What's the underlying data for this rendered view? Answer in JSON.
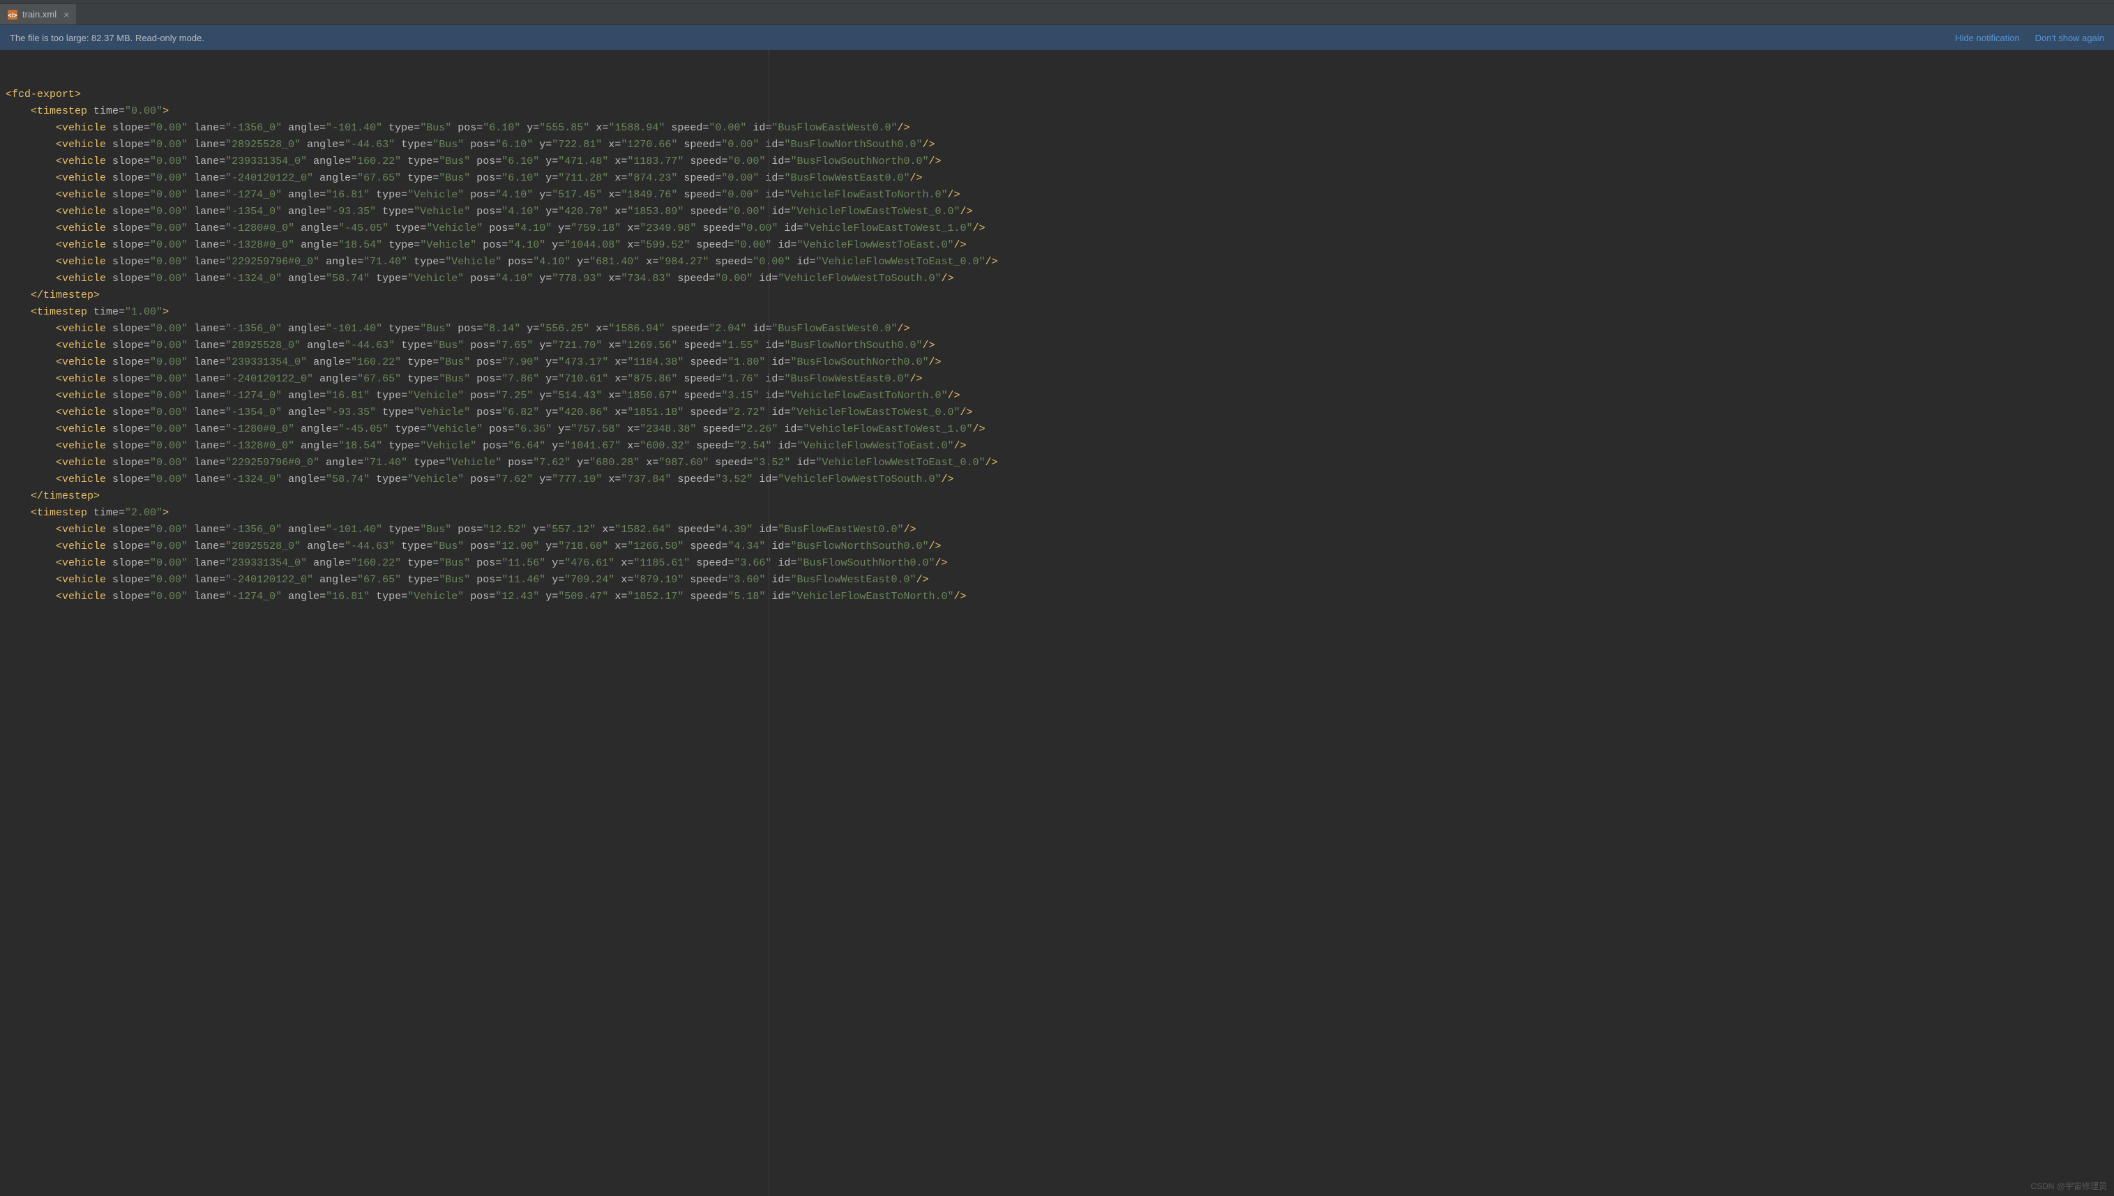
{
  "tab": {
    "filename": "train.xml"
  },
  "notification": {
    "message": "The file is too large: 82.37 MB. Read-only mode.",
    "hide": "Hide notification",
    "dontshow": "Don't show again"
  },
  "watermark": "CSDN @宇宙修理员",
  "xml": {
    "root": "fcd-export",
    "timesteps": [
      {
        "time": "0.00",
        "vehicles": [
          {
            "slope": "0.00",
            "lane": "-1356_0",
            "angle": "-101.40",
            "type": "Bus",
            "pos": "6.10",
            "y": "555.85",
            "x": "1588.94",
            "speed": "0.00",
            "id": "BusFlowEastWest0.0"
          },
          {
            "slope": "0.00",
            "lane": "28925528_0",
            "angle": "-44.63",
            "type": "Bus",
            "pos": "6.10",
            "y": "722.81",
            "x": "1270.66",
            "speed": "0.00",
            "id": "BusFlowNorthSouth0.0"
          },
          {
            "slope": "0.00",
            "lane": "239331354_0",
            "angle": "160.22",
            "type": "Bus",
            "pos": "6.10",
            "y": "471.48",
            "x": "1183.77",
            "speed": "0.00",
            "id": "BusFlowSouthNorth0.0"
          },
          {
            "slope": "0.00",
            "lane": "-240120122_0",
            "angle": "67.65",
            "type": "Bus",
            "pos": "6.10",
            "y": "711.28",
            "x": "874.23",
            "speed": "0.00",
            "id": "BusFlowWestEast0.0"
          },
          {
            "slope": "0.00",
            "lane": "-1274_0",
            "angle": "16.81",
            "type": "Vehicle",
            "pos": "4.10",
            "y": "517.45",
            "x": "1849.76",
            "speed": "0.00",
            "id": "VehicleFlowEastToNorth.0"
          },
          {
            "slope": "0.00",
            "lane": "-1354_0",
            "angle": "-93.35",
            "type": "Vehicle",
            "pos": "4.10",
            "y": "420.70",
            "x": "1853.89",
            "speed": "0.00",
            "id": "VehicleFlowEastToWest_0.0"
          },
          {
            "slope": "0.00",
            "lane": "-1280#0_0",
            "angle": "-45.05",
            "type": "Vehicle",
            "pos": "4.10",
            "y": "759.18",
            "x": "2349.98",
            "speed": "0.00",
            "id": "VehicleFlowEastToWest_1.0"
          },
          {
            "slope": "0.00",
            "lane": "-1328#0_0",
            "angle": "18.54",
            "type": "Vehicle",
            "pos": "4.10",
            "y": "1044.08",
            "x": "599.52",
            "speed": "0.00",
            "id": "VehicleFlowWestToEast.0"
          },
          {
            "slope": "0.00",
            "lane": "229259796#0_0",
            "angle": "71.40",
            "type": "Vehicle",
            "pos": "4.10",
            "y": "681.40",
            "x": "984.27",
            "speed": "0.00",
            "id": "VehicleFlowWestToEast_0.0"
          },
          {
            "slope": "0.00",
            "lane": "-1324_0",
            "angle": "58.74",
            "type": "Vehicle",
            "pos": "4.10",
            "y": "778.93",
            "x": "734.83",
            "speed": "0.00",
            "id": "VehicleFlowWestToSouth.0"
          }
        ]
      },
      {
        "time": "1.00",
        "vehicles": [
          {
            "slope": "0.00",
            "lane": "-1356_0",
            "angle": "-101.40",
            "type": "Bus",
            "pos": "8.14",
            "y": "556.25",
            "x": "1586.94",
            "speed": "2.04",
            "id": "BusFlowEastWest0.0"
          },
          {
            "slope": "0.00",
            "lane": "28925528_0",
            "angle": "-44.63",
            "type": "Bus",
            "pos": "7.65",
            "y": "721.70",
            "x": "1269.56",
            "speed": "1.55",
            "id": "BusFlowNorthSouth0.0"
          },
          {
            "slope": "0.00",
            "lane": "239331354_0",
            "angle": "160.22",
            "type": "Bus",
            "pos": "7.90",
            "y": "473.17",
            "x": "1184.38",
            "speed": "1.80",
            "id": "BusFlowSouthNorth0.0"
          },
          {
            "slope": "0.00",
            "lane": "-240120122_0",
            "angle": "67.65",
            "type": "Bus",
            "pos": "7.86",
            "y": "710.61",
            "x": "875.86",
            "speed": "1.76",
            "id": "BusFlowWestEast0.0"
          },
          {
            "slope": "0.00",
            "lane": "-1274_0",
            "angle": "16.81",
            "type": "Vehicle",
            "pos": "7.25",
            "y": "514.43",
            "x": "1850.67",
            "speed": "3.15",
            "id": "VehicleFlowEastToNorth.0"
          },
          {
            "slope": "0.00",
            "lane": "-1354_0",
            "angle": "-93.35",
            "type": "Vehicle",
            "pos": "6.82",
            "y": "420.86",
            "x": "1851.18",
            "speed": "2.72",
            "id": "VehicleFlowEastToWest_0.0"
          },
          {
            "slope": "0.00",
            "lane": "-1280#0_0",
            "angle": "-45.05",
            "type": "Vehicle",
            "pos": "6.36",
            "y": "757.58",
            "x": "2348.38",
            "speed": "2.26",
            "id": "VehicleFlowEastToWest_1.0"
          },
          {
            "slope": "0.00",
            "lane": "-1328#0_0",
            "angle": "18.54",
            "type": "Vehicle",
            "pos": "6.64",
            "y": "1041.67",
            "x": "600.32",
            "speed": "2.54",
            "id": "VehicleFlowWestToEast.0"
          },
          {
            "slope": "0.00",
            "lane": "229259796#0_0",
            "angle": "71.40",
            "type": "Vehicle",
            "pos": "7.62",
            "y": "680.28",
            "x": "987.60",
            "speed": "3.52",
            "id": "VehicleFlowWestToEast_0.0"
          },
          {
            "slope": "0.00",
            "lane": "-1324_0",
            "angle": "58.74",
            "type": "Vehicle",
            "pos": "7.62",
            "y": "777.10",
            "x": "737.84",
            "speed": "3.52",
            "id": "VehicleFlowWestToSouth.0"
          }
        ]
      },
      {
        "time": "2.00",
        "vehicles": [
          {
            "slope": "0.00",
            "lane": "-1356_0",
            "angle": "-101.40",
            "type": "Bus",
            "pos": "12.52",
            "y": "557.12",
            "x": "1582.64",
            "speed": "4.39",
            "id": "BusFlowEastWest0.0"
          },
          {
            "slope": "0.00",
            "lane": "28925528_0",
            "angle": "-44.63",
            "type": "Bus",
            "pos": "12.00",
            "y": "718.60",
            "x": "1266.50",
            "speed": "4.34",
            "id": "BusFlowNorthSouth0.0"
          },
          {
            "slope": "0.00",
            "lane": "239331354_0",
            "angle": "160.22",
            "type": "Bus",
            "pos": "11.56",
            "y": "476.61",
            "x": "1185.61",
            "speed": "3.66",
            "id": "BusFlowSouthNorth0.0"
          },
          {
            "slope": "0.00",
            "lane": "-240120122_0",
            "angle": "67.65",
            "type": "Bus",
            "pos": "11.46",
            "y": "709.24",
            "x": "879.19",
            "speed": "3.60",
            "id": "BusFlowWestEast0.0"
          },
          {
            "slope": "0.00",
            "lane": "-1274_0",
            "angle": "16.81",
            "type": "Vehicle",
            "pos": "12.43",
            "y": "509.47",
            "x": "1852.17",
            "speed": "5.18",
            "id": "VehicleFlowEastToNorth.0"
          }
        ]
      }
    ]
  }
}
